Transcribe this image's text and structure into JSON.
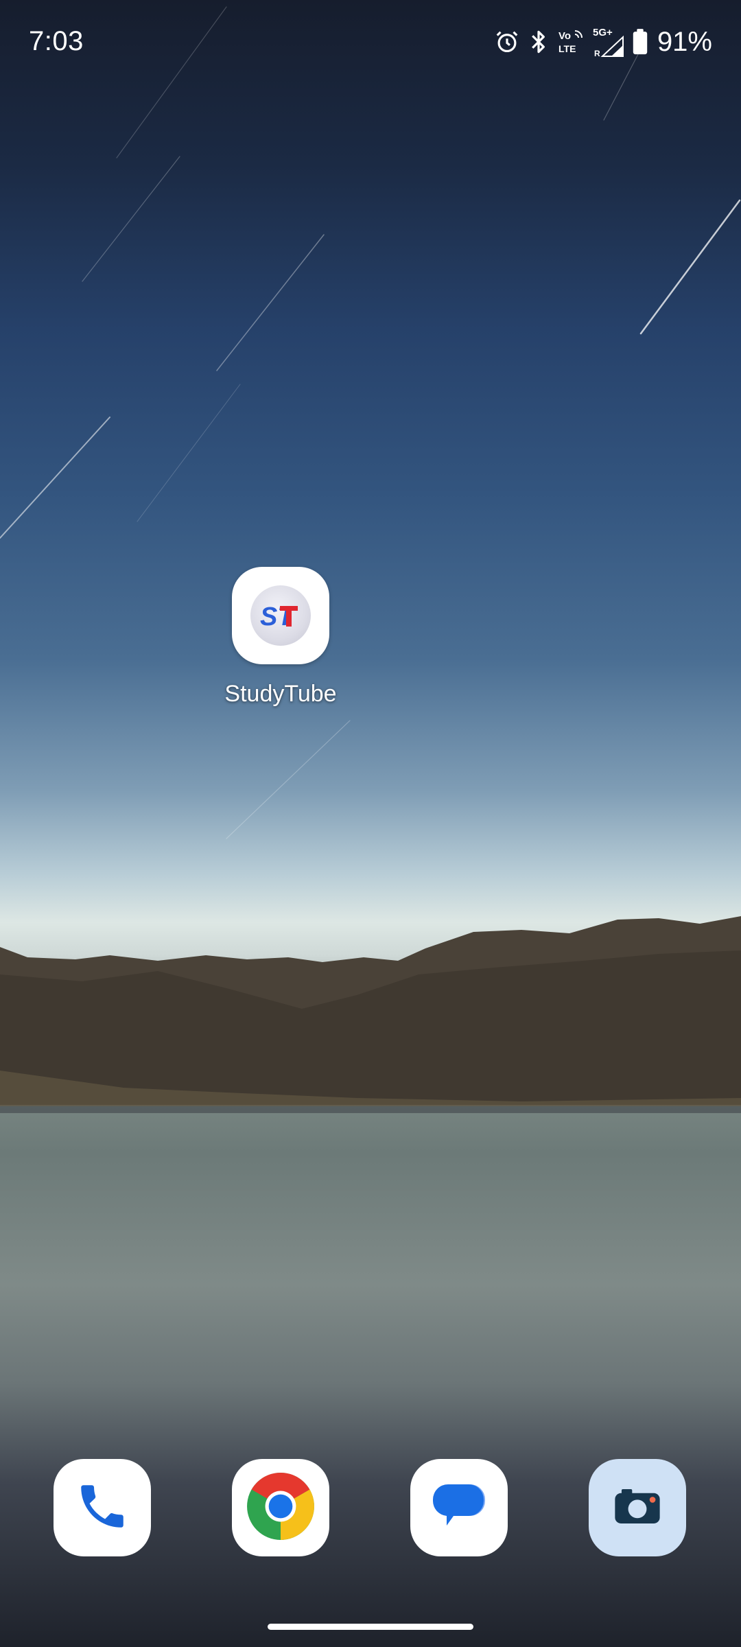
{
  "status_bar": {
    "time": "7:03",
    "network_label": "5G+",
    "volte_label_top": "Vo",
    "volte_label_bottom": "LTE",
    "roaming_label": "R",
    "battery_percent": "91%",
    "icons": [
      "alarm-icon",
      "bluetooth-icon",
      "volte-icon",
      "signal-icon",
      "battery-icon"
    ]
  },
  "home": {
    "apps": [
      {
        "label": "StudyTube",
        "icon": "studytube-icon",
        "icon_text": "ST"
      }
    ]
  },
  "dock": {
    "apps": [
      {
        "icon": "phone-icon"
      },
      {
        "icon": "chrome-icon"
      },
      {
        "icon": "messages-icon"
      },
      {
        "icon": "camera-icon"
      }
    ]
  },
  "colors": {
    "studytube_s": "#2b5fd8",
    "studytube_t": "#e0262f",
    "phone_blue": "#1a66d9",
    "chrome_red": "#e5382e",
    "chrome_yellow": "#f6c01a",
    "chrome_green": "#2fa44f",
    "chrome_blue": "#1a73e8",
    "messages_blue": "#1b6fe5",
    "camera_dark": "#17364d",
    "camera_accent": "#f06c4c"
  }
}
